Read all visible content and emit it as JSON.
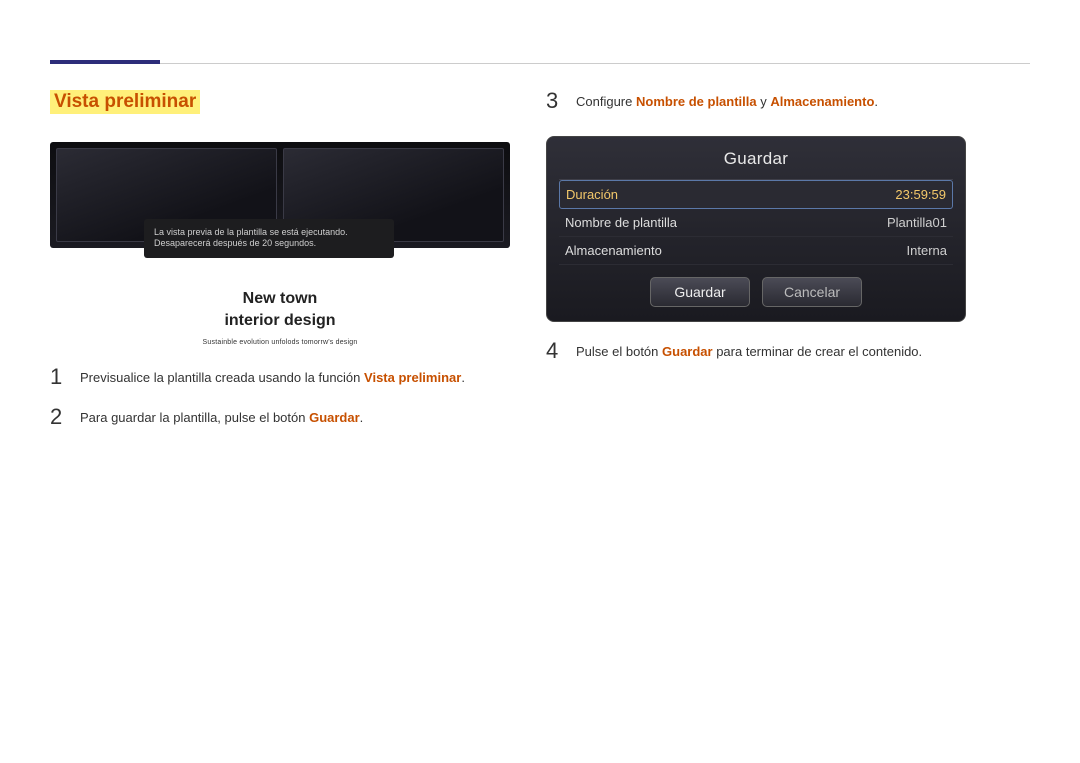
{
  "left": {
    "section_title": "Vista preliminar",
    "toast": "La vista previa de la plantilla se está ejecutando. Desaparecerá después de 20 segundos.",
    "caption_line1": "New town",
    "caption_line2": "interior design",
    "caption_tag": "Sustainble evolution unfolods tomorrw's design",
    "step1": {
      "num": "1",
      "pre": "Previsualice la plantilla creada usando la función ",
      "hl": "Vista preliminar",
      "post": "."
    },
    "step2": {
      "num": "2",
      "pre": "Para guardar la plantilla, pulse el botón ",
      "hl": "Guardar",
      "post": "."
    }
  },
  "right": {
    "step3": {
      "num": "3",
      "pre": "Configure ",
      "hl1": "Nombre de plantilla",
      "mid": " y ",
      "hl2": "Almacenamiento",
      "post": "."
    },
    "dialog": {
      "title": "Guardar",
      "row1_label": "Duración",
      "row1_value": "23:59:59",
      "row2_label": "Nombre de plantilla",
      "row2_value": "Plantilla01",
      "row3_label": "Almacenamiento",
      "row3_value": "Interna",
      "btn_save": "Guardar",
      "btn_cancel": "Cancelar"
    },
    "step4": {
      "num": "4",
      "pre": "Pulse el botón ",
      "hl": "Guardar",
      "post": " para terminar de crear el contenido."
    }
  }
}
